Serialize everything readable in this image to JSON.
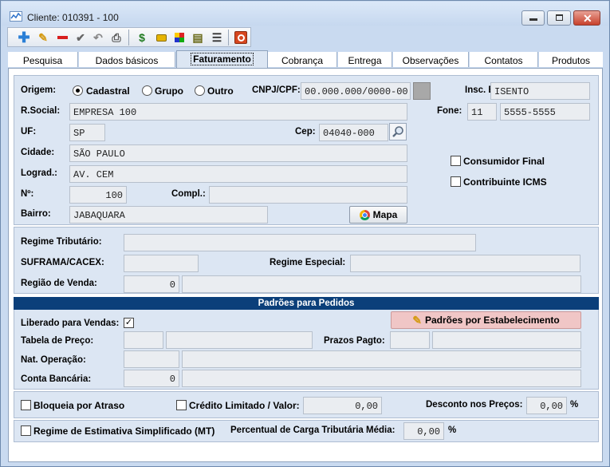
{
  "window": {
    "title": "Cliente: 010391 - 100"
  },
  "tabs": [
    {
      "label": "Pesquisa"
    },
    {
      "label": "Dados básicos"
    },
    {
      "label": "Faturamento"
    },
    {
      "label": "Cobrança"
    },
    {
      "label": "Entrega"
    },
    {
      "label": "Observações"
    },
    {
      "label": "Contatos"
    },
    {
      "label": "Produtos"
    }
  ],
  "active_tab": "Faturamento",
  "toolbar_icons": [
    "add-icon",
    "edit-icon",
    "delete-icon",
    "confirm-icon",
    "undo-icon",
    "print-icon",
    "finance-icon",
    "tag-icon",
    "grid-icon",
    "documents-icon",
    "report-icon",
    "exit-icon"
  ],
  "colors": {
    "band": "#0b3f7a",
    "group_bg": "#dce6f3",
    "highlight_button": "#f0c6c6",
    "field_bg": "#eaedf1"
  },
  "address": {
    "origem_label": "Origem:",
    "origem_options": [
      {
        "label": "Cadastral",
        "selected": true
      },
      {
        "label": "Grupo",
        "selected": false
      },
      {
        "label": "Outro",
        "selected": false
      }
    ],
    "cnpj_label": "CNPJ/CPF:",
    "cnpj_value": "00.000.000/0000-00",
    "insc_label": "Insc. Est.:",
    "insc_value": "ISENTO",
    "rsocial_label": "R.Social:",
    "rsocial_value": "EMPRESA 100",
    "fone_label": "Fone:",
    "fone_ddd": "11",
    "fone_number": "5555-5555",
    "uf_label": "UF:",
    "uf_value": "SP",
    "cep_label": "Cep:",
    "cep_value": "04040-000",
    "cidade_label": "Cidade:",
    "cidade_value": "SÃO PAULO",
    "lograd_label": "Lograd.:",
    "lograd_value": "AV. CEM",
    "numero_label": "Nº:",
    "numero_value": "100",
    "compl_label": "Compl.:",
    "compl_value": "",
    "bairro_label": "Bairro:",
    "bairro_value": "JABAQUARA",
    "mapa_label": "Mapa",
    "consumidor_label": "Consumidor Final",
    "consumidor_checked": false,
    "contribuinte_label": "Contribuinte ICMS",
    "contribuinte_checked": false
  },
  "tax": {
    "regime_label": "Regime Tributário:",
    "regime_value": "",
    "suframa_label": "SUFRAMA/CACEX:",
    "suframa_value": "",
    "regime_especial_label": "Regime Especial:",
    "regime_especial_value": "",
    "regiao_label": "Região de Venda:",
    "regiao_code": "0",
    "regiao_desc": ""
  },
  "orders": {
    "band_title": "Padrões para Pedidos",
    "liberado_label": "Liberado para Vendas:",
    "liberado_checked": true,
    "padroes_button": "Padrões por Estabelecimento",
    "tabela_label": "Tabela de Preço:",
    "tabela_code": "",
    "tabela_desc": "",
    "prazos_label": "Prazos Pagto:",
    "prazos_code": "",
    "prazos_desc": "",
    "nat_label": "Nat. Operação:",
    "nat_code": "",
    "nat_desc": "",
    "conta_label": "Conta Bancária:",
    "conta_code": "0",
    "conta_desc": ""
  },
  "credit": {
    "bloqueia_label": "Bloqueia por Atraso",
    "bloqueia_checked": false,
    "credito_label": "Crédito Limitado / Valor:",
    "credito_checked": false,
    "credito_value": "0,00",
    "desconto_label": "Desconto nos Preços:",
    "desconto_value": "0,00",
    "desconto_unit": "%"
  },
  "estimativa": {
    "regime_label": "Regime de Estimativa Simplificado (MT)",
    "regime_checked": false,
    "percentual_label": "Percentual de Carga Tributária Média:",
    "percentual_value": "0,00",
    "percentual_unit": "%"
  }
}
